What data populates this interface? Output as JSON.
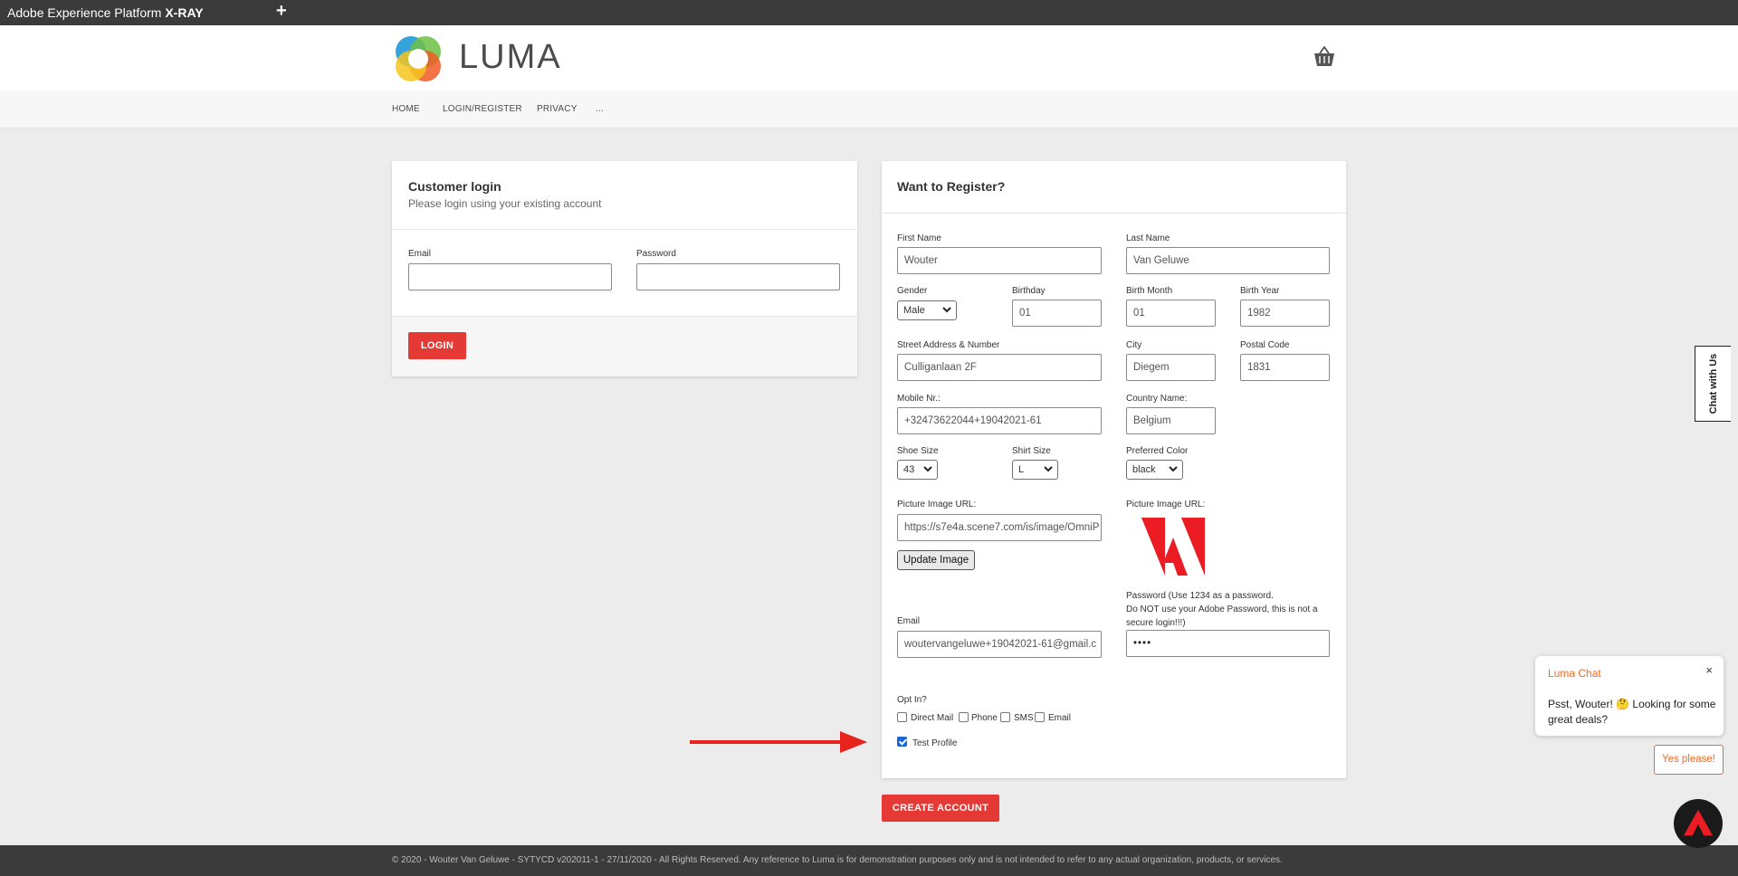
{
  "xray": {
    "title_prefix": "Adobe Experience Platform ",
    "title_bold": "X-RAY",
    "add": "+"
  },
  "header": {
    "brand": "LUMA",
    "logo_icon": "luma-logo",
    "cart_icon": "basket-icon"
  },
  "nav": {
    "items": [
      "HOME",
      "LOGIN/REGISTER",
      "PRIVACY",
      "..."
    ]
  },
  "login": {
    "title": "Customer login",
    "subtitle": "Please login using your existing account",
    "email_label": "Email",
    "password_label": "Password",
    "button": "LOGIN"
  },
  "register": {
    "title": "Want to Register?",
    "first_name": {
      "label": "First Name",
      "value": "Wouter"
    },
    "last_name": {
      "label": "Last Name",
      "value": "Van Geluwe"
    },
    "gender": {
      "label": "Gender",
      "value": "Male"
    },
    "birthday": {
      "label": "Birthday",
      "value": "01"
    },
    "birth_month": {
      "label": "Birth Month",
      "value": "01"
    },
    "birth_year": {
      "label": "Birth Year",
      "value": "1982"
    },
    "street": {
      "label": "Street Address & Number",
      "value": "Culliganlaan 2F"
    },
    "city": {
      "label": "City",
      "value": "Diegem"
    },
    "postal": {
      "label": "Postal Code",
      "value": "1831"
    },
    "mobile": {
      "label": "Mobile Nr.:",
      "value": "+32473622044+19042021-61"
    },
    "country": {
      "label": "Country Name:",
      "value": "Belgium"
    },
    "shoe_size": {
      "label": "Shoe Size",
      "value": "43"
    },
    "shirt_size": {
      "label": "Shirt Size",
      "value": "L"
    },
    "color": {
      "label": "Preferred Color",
      "value": "black"
    },
    "picture_url": {
      "label": "Picture Image URL:",
      "value": "https://s7e4a.scene7.com/is/image/OmniP"
    },
    "picture_preview_label": "Picture Image URL:",
    "update_button": "Update Image",
    "email": {
      "label": "Email",
      "value": "woutervangeluwe+19042021-61@gmail.c"
    },
    "password_note_1": "Password (Use 1234 as a password.",
    "password_note_2": "Do NOT use your Adobe Password, this is not a",
    "password_note_3": "secure login!!!)",
    "password_value": "••••",
    "opt_in_label": "Opt In?",
    "opt_direct_mail": "Direct Mail",
    "opt_phone": "Phone",
    "opt_sms": "SMS",
    "opt_email": "Email",
    "test_profile": "Test Profile",
    "test_profile_checked": true,
    "create_button": "CREATE ACCOUNT"
  },
  "footer": {
    "text": "© 2020 - Wouter Van Geluwe - SYTYCD v202011-1 - 27/11/2020 - All Rights Reserved. Any reference to Luma is for demonstration purposes only and is not intended to refer to any actual organization, products, or services."
  },
  "chat": {
    "tab_label": "Chat with Us",
    "popup_title": "Luma Chat",
    "close": "×",
    "message": "Psst, Wouter! 🤔 Looking for some great deals?",
    "yes_button": "Yes please!"
  },
  "colors": {
    "accent_red": "#e53935",
    "chat_orange": "#f06a24",
    "arrow_red": "#e8221c"
  }
}
